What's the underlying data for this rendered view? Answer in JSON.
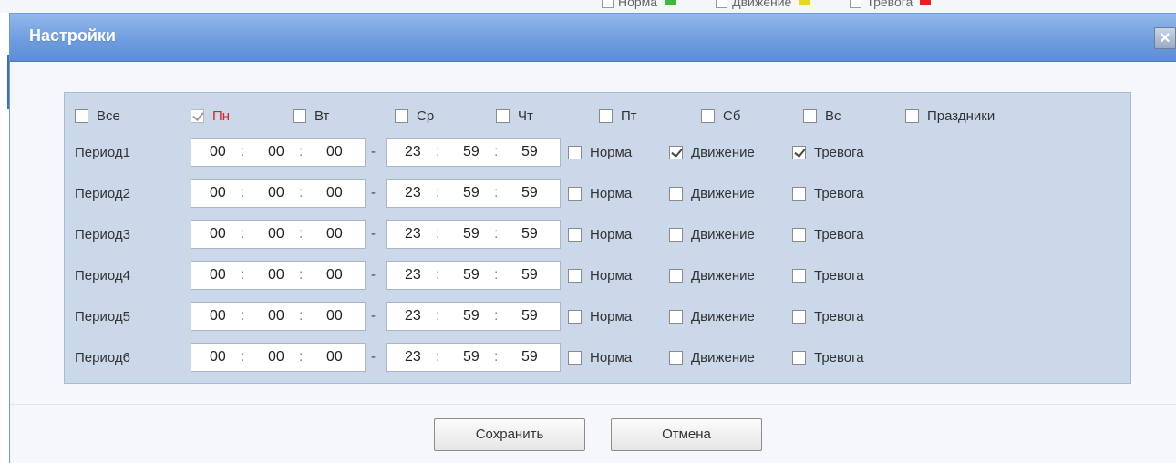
{
  "background": {
    "legend": [
      {
        "label": "Норма",
        "color": "#3cb83c"
      },
      {
        "label": "Движение",
        "color": "#e8d81c"
      },
      {
        "label": "Тревога",
        "color": "#e02424"
      }
    ]
  },
  "dialog": {
    "title": "Настройки",
    "close_label": "×",
    "days": [
      {
        "label": "Все",
        "checked": false
      },
      {
        "label": "Пн",
        "checked": true
      },
      {
        "label": "Вт",
        "checked": false
      },
      {
        "label": "Ср",
        "checked": false
      },
      {
        "label": "Чт",
        "checked": false
      },
      {
        "label": "Пт",
        "checked": false
      },
      {
        "label": "Сб",
        "checked": false
      },
      {
        "label": "Вс",
        "checked": false
      },
      {
        "label": "Праздники",
        "checked": false
      }
    ],
    "time_separator": ":",
    "range_separator": "-",
    "option_labels": {
      "normal": "Норма",
      "motion": "Движение",
      "alarm": "Тревога"
    },
    "periods": [
      {
        "label": "Период1",
        "start": [
          "00",
          "00",
          "00"
        ],
        "end": [
          "23",
          "59",
          "59"
        ],
        "normal": false,
        "motion": true,
        "alarm": true
      },
      {
        "label": "Период2",
        "start": [
          "00",
          "00",
          "00"
        ],
        "end": [
          "23",
          "59",
          "59"
        ],
        "normal": false,
        "motion": false,
        "alarm": false
      },
      {
        "label": "Период3",
        "start": [
          "00",
          "00",
          "00"
        ],
        "end": [
          "23",
          "59",
          "59"
        ],
        "normal": false,
        "motion": false,
        "alarm": false
      },
      {
        "label": "Период4",
        "start": [
          "00",
          "00",
          "00"
        ],
        "end": [
          "23",
          "59",
          "59"
        ],
        "normal": false,
        "motion": false,
        "alarm": false
      },
      {
        "label": "Период5",
        "start": [
          "00",
          "00",
          "00"
        ],
        "end": [
          "23",
          "59",
          "59"
        ],
        "normal": false,
        "motion": false,
        "alarm": false
      },
      {
        "label": "Период6",
        "start": [
          "00",
          "00",
          "00"
        ],
        "end": [
          "23",
          "59",
          "59"
        ],
        "normal": false,
        "motion": false,
        "alarm": false
      }
    ],
    "buttons": {
      "save": "Сохранить",
      "cancel": "Отмена"
    }
  }
}
